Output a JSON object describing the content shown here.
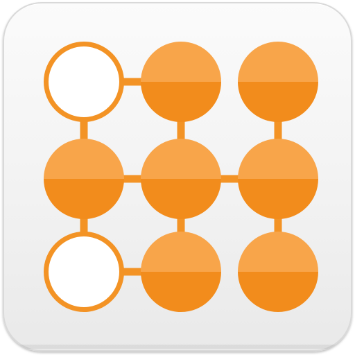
{
  "icon": {
    "name": "pattern-lock-app-icon",
    "grid": {
      "rows": 3,
      "cols": 3,
      "dots": [
        {
          "row": 0,
          "col": 0,
          "state": "empty"
        },
        {
          "row": 0,
          "col": 1,
          "state": "filled"
        },
        {
          "row": 0,
          "col": 2,
          "state": "filled"
        },
        {
          "row": 1,
          "col": 0,
          "state": "filled"
        },
        {
          "row": 1,
          "col": 1,
          "state": "filled"
        },
        {
          "row": 1,
          "col": 2,
          "state": "filled"
        },
        {
          "row": 2,
          "col": 0,
          "state": "empty"
        },
        {
          "row": 2,
          "col": 1,
          "state": "filled"
        },
        {
          "row": 2,
          "col": 2,
          "state": "filled"
        }
      ],
      "links": [
        {
          "from": [
            0,
            0
          ],
          "to": [
            0,
            1
          ]
        },
        {
          "from": [
            0,
            0
          ],
          "to": [
            1,
            0
          ]
        },
        {
          "from": [
            0,
            1
          ],
          "to": [
            1,
            1
          ]
        },
        {
          "from": [
            0,
            2
          ],
          "to": [
            1,
            2
          ]
        },
        {
          "from": [
            1,
            0
          ],
          "to": [
            1,
            1
          ]
        },
        {
          "from": [
            1,
            1
          ],
          "to": [
            1,
            2
          ]
        },
        {
          "from": [
            1,
            0
          ],
          "to": [
            2,
            0
          ]
        },
        {
          "from": [
            1,
            1
          ],
          "to": [
            2,
            1
          ]
        },
        {
          "from": [
            1,
            2
          ],
          "to": [
            2,
            2
          ]
        },
        {
          "from": [
            2,
            0
          ],
          "to": [
            2,
            1
          ]
        }
      ]
    },
    "colors": {
      "dot_fill_top": "#f8a54a",
      "dot_fill_bottom": "#f28c1c",
      "outline": "#f39325",
      "tile": "#f2f2f2"
    }
  }
}
